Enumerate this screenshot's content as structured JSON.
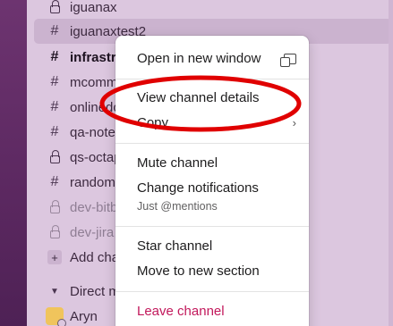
{
  "sidebar": {
    "channels": [
      {
        "type": "private",
        "name": "iguanax",
        "style": "normal"
      },
      {
        "type": "public",
        "name": "iguanaxtest2",
        "style": "highlight"
      },
      {
        "type": "public",
        "name": "infrastru",
        "style": "bold"
      },
      {
        "type": "public",
        "name": "mcomm",
        "style": "normal"
      },
      {
        "type": "public",
        "name": "onlinedo",
        "style": "normal"
      },
      {
        "type": "public",
        "name": "qa-note",
        "style": "normal"
      },
      {
        "type": "private",
        "name": "qs-octap",
        "style": "normal"
      },
      {
        "type": "public",
        "name": "random",
        "style": "normal"
      },
      {
        "type": "private",
        "name": "dev-bitb",
        "style": "muted"
      },
      {
        "type": "private",
        "name": "dev-jira",
        "style": "muted"
      }
    ],
    "add_channel_label": "Add cha",
    "dm_section_label": "Direct m",
    "dm_user": "Aryn"
  },
  "context_menu": {
    "open_new_window": "Open in new window",
    "view_details": "View channel details",
    "copy": "Copy",
    "mute": "Mute channel",
    "change_notifications": "Change notifications",
    "notifications_value": "Just @mentions",
    "star": "Star channel",
    "move": "Move to new section",
    "leave": "Leave channel"
  },
  "colors": {
    "rail": "#5b2860",
    "sidebar": "#dcc7df",
    "annotation": "#e00000",
    "danger": "#c2185b"
  },
  "icons": {
    "public": "hash-icon",
    "private": "lock-icon",
    "new_window": "new-window-icon",
    "submenu": "chevron-right-icon"
  }
}
